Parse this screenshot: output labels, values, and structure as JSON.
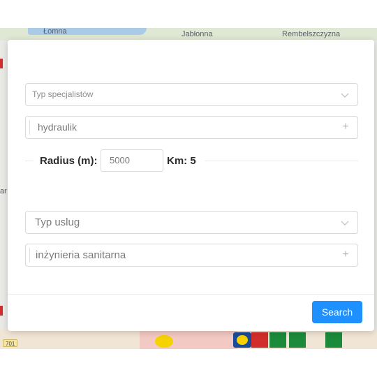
{
  "map": {
    "labels": {
      "lomna": "Łomna",
      "jablonna": "Jabłonna",
      "rembelszczyzna": "Rembelszczyzna",
      "road": "701"
    }
  },
  "modal": {
    "specialist_type": {
      "placeholder": "Typ specjalistów"
    },
    "specialist_tag": {
      "value": "hydraulik"
    },
    "radius": {
      "label": "Radius (m):",
      "value": "5000",
      "km_label": "Km: 5"
    },
    "service_type": {
      "placeholder": "Typ uslug"
    },
    "service_tag": {
      "value": "inżynieria sanitarna"
    },
    "search_button": "Search"
  },
  "colors": {
    "accent": "#1e90ff",
    "border": "#d9d9d9",
    "text_muted": "#7a7a7a"
  },
  "icons": {
    "select_arrow": "chevron-down-icon",
    "add": "plus-icon"
  }
}
